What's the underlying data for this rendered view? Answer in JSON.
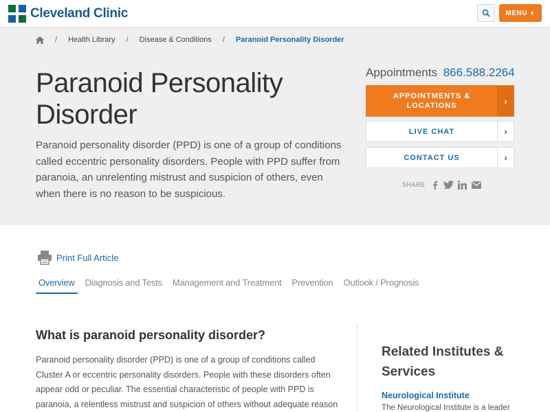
{
  "header": {
    "logo_text": "Cleveland Clinic",
    "menu_label": "MENU",
    "brand_color": "#1c5a8f",
    "accent_color": "#ef7b20"
  },
  "breadcrumb": {
    "items": [
      "Health Library",
      "Disease & Conditions"
    ],
    "current": "Paranoid Personality Disorder",
    "separator": "/"
  },
  "hero": {
    "title": "Paranoid Personality Disorder",
    "intro": "Paranoid personality disorder (PPD) is one of a group of conditions called eccentric personality disorders. People with PPD suffer from paranoia, an unrelenting mistrust and suspicion of others, even when there is no reason to be suspicious."
  },
  "sidebar": {
    "appointments_label": "Appointments",
    "phone": "866.588.2264",
    "buttons": [
      {
        "label": "APPOINTMENTS & LOCATIONS",
        "icon": "chevron-right-icon"
      },
      {
        "label": "LIVE CHAT",
        "icon": "chevron-right-icon"
      },
      {
        "label": "CONTACT US",
        "icon": "chevron-right-icon"
      }
    ],
    "share_label": "SHARE",
    "share_icons": [
      "facebook-icon",
      "twitter-icon",
      "linkedin-icon",
      "email-icon"
    ]
  },
  "article": {
    "print_label": "Print Full Article",
    "tabs": [
      "Overview",
      "Diagnosis and Tests",
      "Management and Treatment",
      "Prevention",
      "Outlook / Prognosis"
    ],
    "active_tab": "Overview",
    "section_heading": "What is paranoid personality disorder?",
    "section_body": "Paranoid personality disorder (PPD) is one of a group of conditions called Cluster A or eccentric personality disorders. People with these disorders often appear odd or peculiar. The essential characteristic of people with PPD is paranoia, a relentless mistrust and suspicion of others without adequate reason"
  },
  "related": {
    "heading": "Related Institutes & Services",
    "link": "Neurological Institute",
    "desc": "The Neurological Institute is a leader"
  }
}
